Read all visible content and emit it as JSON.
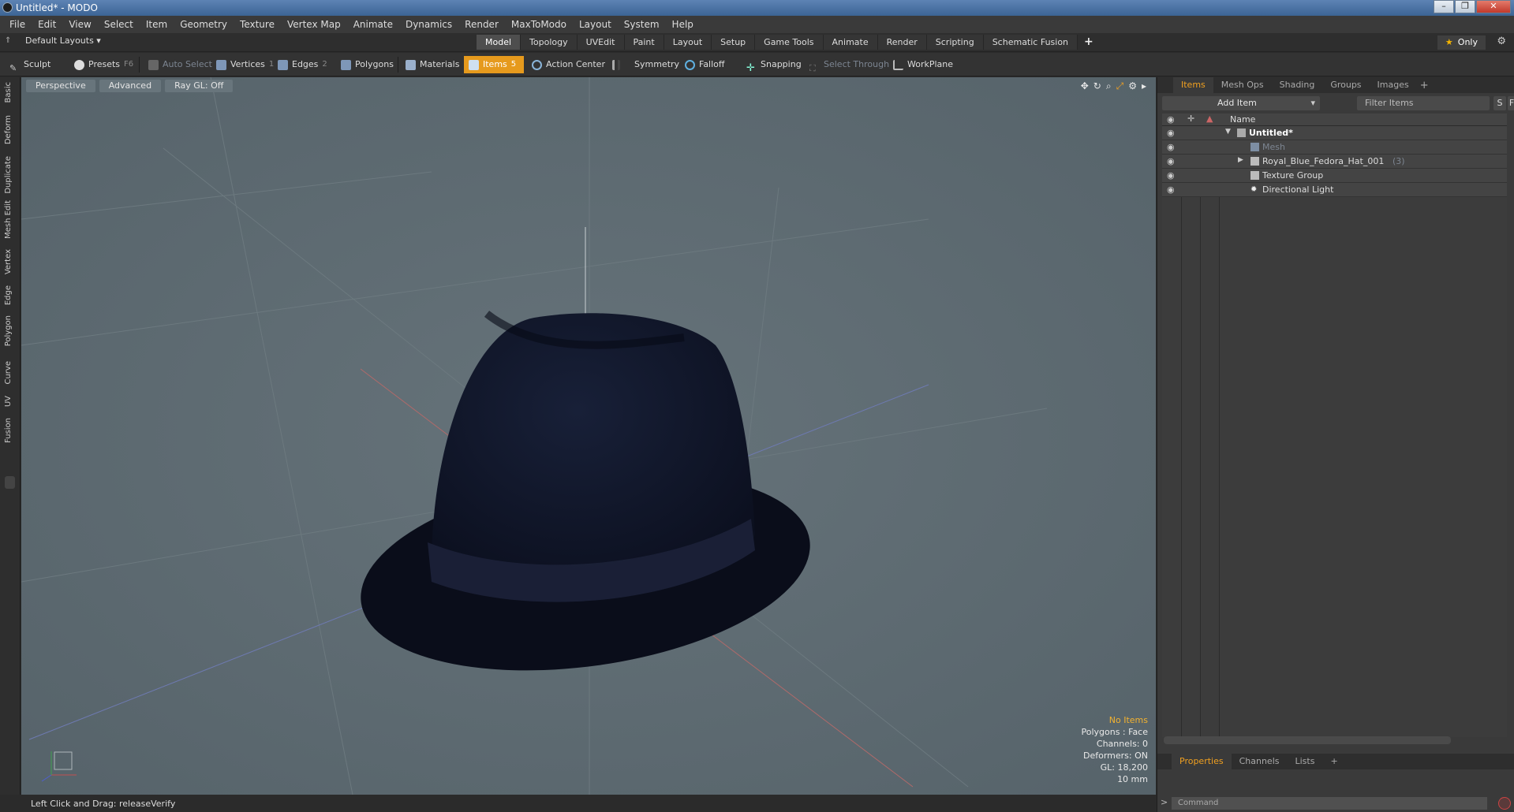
{
  "window": {
    "title": "Untitled* - MODO",
    "controls": [
      "–",
      "❐",
      "✕"
    ]
  },
  "menu": [
    "File",
    "Edit",
    "View",
    "Select",
    "Item",
    "Geometry",
    "Texture",
    "Vertex Map",
    "Animate",
    "Dynamics",
    "Render",
    "MaxToModo",
    "Layout",
    "System",
    "Help"
  ],
  "layouts": {
    "label": "Default Layouts ▾"
  },
  "tabs": [
    "Model",
    "Topology",
    "UVEdit",
    "Paint",
    "Layout",
    "Setup",
    "Game Tools",
    "Animate",
    "Render",
    "Scripting",
    "Schematic Fusion"
  ],
  "tabs_active": "Model",
  "tabs_plus": "+",
  "only_label": "Only",
  "toolbar": {
    "sculpt": "Sculpt",
    "presets": "Presets",
    "presets_key": "F6",
    "auto_select": "Auto Select",
    "vertices": "Vertices",
    "vertices_key": "1",
    "edges": "Edges",
    "edges_key": "2",
    "polygons": "Polygons",
    "materials": "Materials",
    "items": "Items",
    "items_key": "5",
    "action_center": "Action Center",
    "symmetry": "Symmetry",
    "falloff": "Falloff",
    "snapping": "Snapping",
    "select_through": "Select Through",
    "workplane": "WorkPlane"
  },
  "left_tabs": [
    "Basic",
    "Deform",
    "Duplicate",
    "Mesh Edit",
    "Vertex",
    "Edge",
    "Polygon",
    "Curve",
    "UV",
    "Fusion"
  ],
  "viewport": {
    "view": "Perspective",
    "mode": "Advanced",
    "raygl": "Ray GL: Off",
    "info": {
      "selection": "No Items",
      "polygons": "Polygons : Face",
      "channels": "Channels: 0",
      "deformers": "Deformers: ON",
      "gl": "GL: 18,200",
      "grid": "10 mm"
    }
  },
  "status": {
    "text": "Left Click and Drag:  releaseVerify"
  },
  "items_panel": {
    "tabs": [
      "Items",
      "Mesh Ops",
      "Shading",
      "Groups",
      "Images"
    ],
    "tabs_plus": "+",
    "add_item": "Add Item",
    "filter_placeholder": "Filter Items",
    "s_btn": "S",
    "f_btn": "F",
    "name_header": "Name",
    "scene_name": "Untitled*",
    "mesh_name": "Mesh",
    "hat_name": "Royal_Blue_Fedora_Hat_001",
    "hat_count": "(3)",
    "texture_group": "Texture Group",
    "light": "Directional Light"
  },
  "properties_panel": {
    "tabs": [
      "Properties",
      "Channels",
      "Lists"
    ],
    "tabs_plus": "+",
    "command_placeholder": "Command"
  },
  "colors": {
    "accent": "#e69a1d",
    "hat": "#141a30",
    "viewport_bg": "#5f6c73"
  }
}
